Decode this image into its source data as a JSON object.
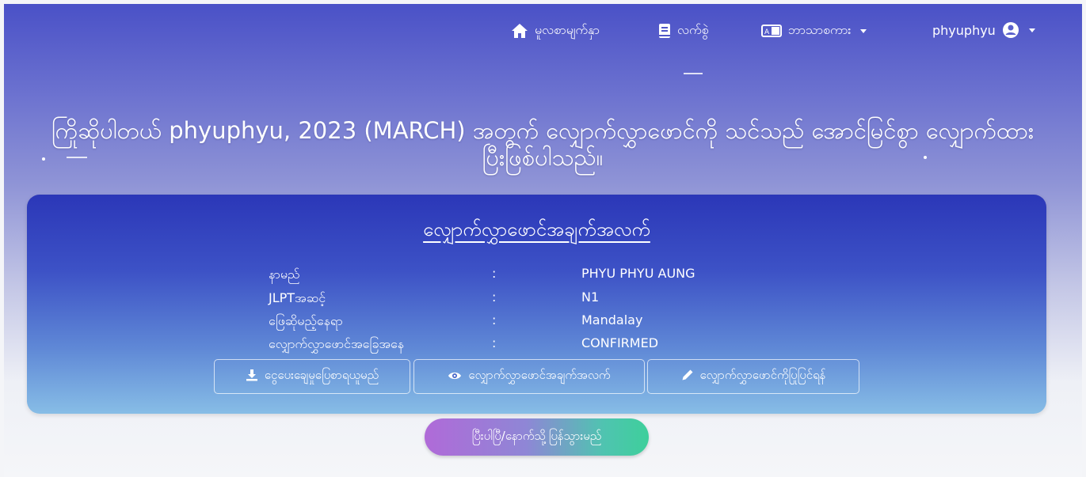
{
  "nav": {
    "home_label": "မူလစာမျက်နှာ",
    "ticket_label": "လက်စွဲ",
    "language_label": "ဘာသာစကား",
    "user_label": "phyuphyu"
  },
  "headline": "ကြိုဆိုပါတယ် phyuphyu, 2023 (MARCH) အတွက် လျှောက်လွှာဖောင်ကို သင်သည် အောင်မြင်စွာ လျှောက်ထားပြီးဖြစ်ပါသည်။",
  "card": {
    "title": "လျှောက်လွှာဖောင်အချက်အလက်",
    "rows": [
      {
        "label": "နာမည်",
        "colon": ":",
        "value": "PHYU PHYU AUNG"
      },
      {
        "label": "JLPTအဆင့်",
        "colon": ":",
        "value": "N1"
      },
      {
        "label": "ဖြေဆိုမည့်နေရာ",
        "colon": ":",
        "value": "Mandalay"
      },
      {
        "label": "လျှောက်လွှာဖောင်အခြေအနေ",
        "colon": ":",
        "value": "CONFIRMED"
      }
    ],
    "buttons": {
      "receipt": "ငွေပေးချေမှုပြေစာရယူမည်",
      "details": "လျှောက်လွှာဖောင်အချက်အလက်",
      "edit": "လျှောက်လွှာဖောင်ကိုပြုပြင်ရန်"
    }
  },
  "done_button": "ပြီးပါပြီ/နောက်သို့ပြန်သွားမည်",
  "icons": {
    "home": "home-icon",
    "ticket": "book-icon",
    "language": "translate-icon",
    "user": "user-circle-icon",
    "download": "download-icon",
    "eye": "eye-icon",
    "pencil": "pencil-icon"
  }
}
